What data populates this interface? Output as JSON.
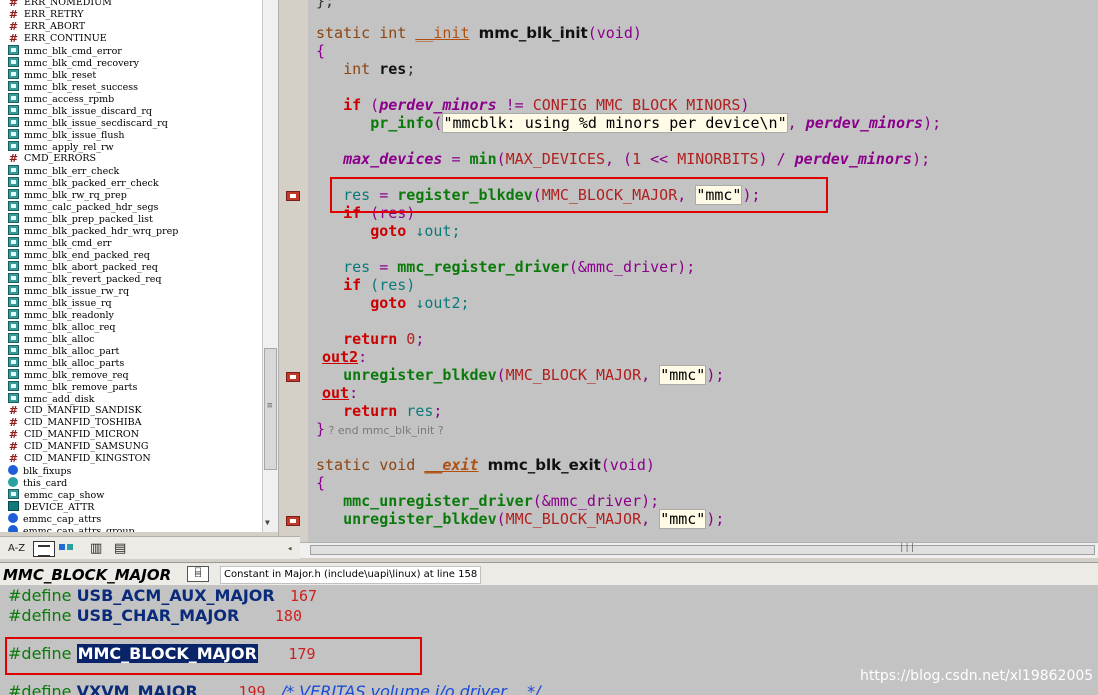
{
  "symbols": [
    {
      "name": "ERR_NOMEDIUM",
      "kind": "macro"
    },
    {
      "name": "ERR_RETRY",
      "kind": "macro"
    },
    {
      "name": "ERR_ABORT",
      "kind": "macro"
    },
    {
      "name": "ERR_CONTINUE",
      "kind": "macro"
    },
    {
      "name": "mmc_blk_cmd_error",
      "kind": "function"
    },
    {
      "name": "mmc_blk_cmd_recovery",
      "kind": "function"
    },
    {
      "name": "mmc_blk_reset",
      "kind": "function"
    },
    {
      "name": "mmc_blk_reset_success",
      "kind": "function"
    },
    {
      "name": "mmc_access_rpmb",
      "kind": "function"
    },
    {
      "name": "mmc_blk_issue_discard_rq",
      "kind": "function"
    },
    {
      "name": "mmc_blk_issue_secdiscard_rq",
      "kind": "function"
    },
    {
      "name": "mmc_blk_issue_flush",
      "kind": "function"
    },
    {
      "name": "mmc_apply_rel_rw",
      "kind": "function"
    },
    {
      "name": "CMD_ERRORS",
      "kind": "macro"
    },
    {
      "name": "mmc_blk_err_check",
      "kind": "function"
    },
    {
      "name": "mmc_blk_packed_err_check",
      "kind": "function"
    },
    {
      "name": "mmc_blk_rw_rq_prep",
      "kind": "function"
    },
    {
      "name": "mmc_calc_packed_hdr_segs",
      "kind": "function"
    },
    {
      "name": "mmc_blk_prep_packed_list",
      "kind": "function"
    },
    {
      "name": "mmc_blk_packed_hdr_wrq_prep",
      "kind": "function"
    },
    {
      "name": "mmc_blk_cmd_err",
      "kind": "function"
    },
    {
      "name": "mmc_blk_end_packed_req",
      "kind": "function"
    },
    {
      "name": "mmc_blk_abort_packed_req",
      "kind": "function"
    },
    {
      "name": "mmc_blk_revert_packed_req",
      "kind": "function"
    },
    {
      "name": "mmc_blk_issue_rw_rq",
      "kind": "function"
    },
    {
      "name": "mmc_blk_issue_rq",
      "kind": "function"
    },
    {
      "name": "mmc_blk_readonly",
      "kind": "function"
    },
    {
      "name": "mmc_blk_alloc_req",
      "kind": "function"
    },
    {
      "name": "mmc_blk_alloc",
      "kind": "function"
    },
    {
      "name": "mmc_blk_alloc_part",
      "kind": "function"
    },
    {
      "name": "mmc_blk_alloc_parts",
      "kind": "function"
    },
    {
      "name": "mmc_blk_remove_req",
      "kind": "function"
    },
    {
      "name": "mmc_blk_remove_parts",
      "kind": "function"
    },
    {
      "name": "mmc_add_disk",
      "kind": "function"
    },
    {
      "name": "CID_MANFID_SANDISK",
      "kind": "macro"
    },
    {
      "name": "CID_MANFID_TOSHIBA",
      "kind": "macro"
    },
    {
      "name": "CID_MANFID_MICRON",
      "kind": "macro"
    },
    {
      "name": "CID_MANFID_SAMSUNG",
      "kind": "macro"
    },
    {
      "name": "CID_MANFID_KINGSTON",
      "kind": "macro"
    },
    {
      "name": "blk_fixups",
      "kind": "variable"
    },
    {
      "name": "this_card",
      "kind": "variable2"
    },
    {
      "name": "emmc_cap_show",
      "kind": "function"
    },
    {
      "name": "DEVICE_ATTR",
      "kind": "struct"
    },
    {
      "name": "emmc_cap_attrs",
      "kind": "variable"
    },
    {
      "name": "emmc_cap_attrs_group",
      "kind": "variable"
    }
  ],
  "code": {
    "l0": "};",
    "l1_static": "static",
    "l1_int": "int",
    "l1_init": "__init",
    "l1_fn": "mmc_blk_init",
    "l1_params": "(void)",
    "l2": "{",
    "l3_int": "int",
    "l3_var": "res",
    "l3_semi": ";",
    "l5_if": "if",
    "l5_open": " (",
    "l5_var": "perdev_minors",
    "l5_op": " != ",
    "l5_macro": "CONFIG_MMC_BLOCK_MINORS",
    "l5_close": ")",
    "l6_fn": "pr_info",
    "l6_open": "(",
    "l6_str": "\"mmcblk: using %d minors per device\\n\"",
    "l6_comma": ", ",
    "l6_var": "perdev_minors",
    "l6_close": ");",
    "l8_var": "max_devices",
    "l8_eq": " = ",
    "l8_fn": "min",
    "l8_open": "(",
    "l8_macro1": "MAX_DEVICES",
    "l8_mid1": ", (",
    "l8_num": "1",
    "l8_shift": " << ",
    "l8_macro2": "MINORBITS",
    "l8_div": ") / ",
    "l8_var2": "perdev_minors",
    "l8_close": ");",
    "l10_var": "res",
    "l10_eq": " = ",
    "l10_fn": "register_blkdev",
    "l10_open": "(",
    "l10_macro": "MMC_BLOCK_MAJOR",
    "l10_comma": ", ",
    "l10_str": "\"mmc\"",
    "l10_close": ");",
    "l11_if": "if",
    "l11_cond": " (res)",
    "l12_goto": "goto",
    "l12_target": " ↓out;",
    "l14_var": "res",
    "l14_eq": " = ",
    "l14_fn": "mmc_register_driver",
    "l14_args": "(&mmc_driver);",
    "l15_if": "if",
    "l15_cond": " (res)",
    "l16_goto": "goto",
    "l16_target": " ↓out2;",
    "l18_ret": "return",
    "l18_num": " 0",
    "l18_semi": ";",
    "l19_label": "out2",
    "l19_colon": ":",
    "l20_fn": "unregister_blkdev",
    "l20_open": "(",
    "l20_macro": "MMC_BLOCK_MAJOR",
    "l20_comma": ", ",
    "l20_str": "\"mmc\"",
    "l20_close": ");",
    "l21_label": "out",
    "l21_colon": ":",
    "l22_ret": "return",
    "l22_var": " res",
    "l22_semi": ";",
    "l23_brace": "}",
    "l23_cmt": " ? end mmc_blk_init ?",
    "l25_static": "static",
    "l25_void": "void",
    "l25_exit": "__exit",
    "l25_fn": "mmc_blk_exit",
    "l25_params": "(void)",
    "l26": "{",
    "l27_fn": "mmc_unregister_driver",
    "l27_args": "(&mmc_driver);",
    "l28_fn": "unregister_blkdev",
    "l28_open": "(",
    "l28_macro": "MMC_BLOCK_MAJOR",
    "l28_comma": ", ",
    "l28_str": "\"mmc\"",
    "l28_close": ");"
  },
  "toolbar": {
    "sort_label": "A-Z"
  },
  "context": {
    "symbol": "MMC_BLOCK_MAJOR",
    "location": "Constant in Major.h (include\\uapi\\linux) at line 158",
    "lines": [
      {
        "pp": "#define",
        "name": "USB_ACM_AUX_MAJOR",
        "pad": "   ",
        "value": "167",
        "selected": false
      },
      {
        "pp": "#define",
        "name": "USB_CHAR_MAJOR",
        "pad": "       ",
        "value": "180",
        "selected": false
      },
      {
        "pp": "#define",
        "name": "MMC_BLOCK_MAJOR",
        "pad": "      ",
        "value": "179",
        "selected": true
      },
      {
        "pp": "#define",
        "name": "VXVM_MAJOR",
        "pad": "        ",
        "value": "199",
        "selected": false,
        "comment": "/* VERITAS volume i/o driver    */"
      }
    ]
  },
  "watermark": "https://blog.csdn.net/xl19862005"
}
